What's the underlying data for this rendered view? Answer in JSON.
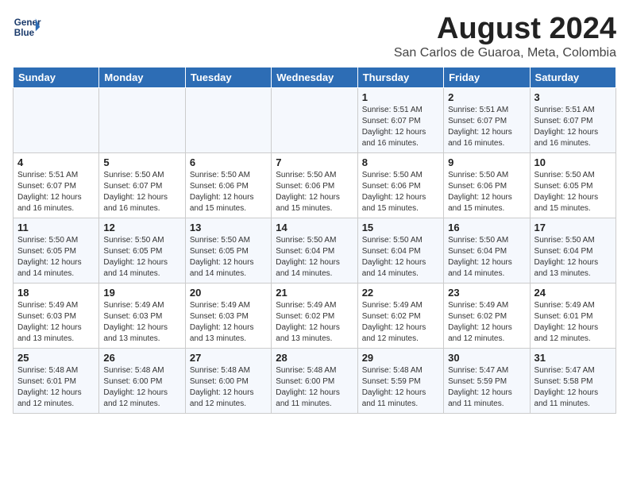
{
  "header": {
    "logo_line1": "General",
    "logo_line2": "Blue",
    "title": "August 2024",
    "subtitle": "San Carlos de Guaroa, Meta, Colombia"
  },
  "weekdays": [
    "Sunday",
    "Monday",
    "Tuesday",
    "Wednesday",
    "Thursday",
    "Friday",
    "Saturday"
  ],
  "weeks": [
    [
      {
        "day": "",
        "info": ""
      },
      {
        "day": "",
        "info": ""
      },
      {
        "day": "",
        "info": ""
      },
      {
        "day": "",
        "info": ""
      },
      {
        "day": "1",
        "info": "Sunrise: 5:51 AM\nSunset: 6:07 PM\nDaylight: 12 hours\nand 16 minutes."
      },
      {
        "day": "2",
        "info": "Sunrise: 5:51 AM\nSunset: 6:07 PM\nDaylight: 12 hours\nand 16 minutes."
      },
      {
        "day": "3",
        "info": "Sunrise: 5:51 AM\nSunset: 6:07 PM\nDaylight: 12 hours\nand 16 minutes."
      }
    ],
    [
      {
        "day": "4",
        "info": "Sunrise: 5:51 AM\nSunset: 6:07 PM\nDaylight: 12 hours\nand 16 minutes."
      },
      {
        "day": "5",
        "info": "Sunrise: 5:50 AM\nSunset: 6:07 PM\nDaylight: 12 hours\nand 16 minutes."
      },
      {
        "day": "6",
        "info": "Sunrise: 5:50 AM\nSunset: 6:06 PM\nDaylight: 12 hours\nand 15 minutes."
      },
      {
        "day": "7",
        "info": "Sunrise: 5:50 AM\nSunset: 6:06 PM\nDaylight: 12 hours\nand 15 minutes."
      },
      {
        "day": "8",
        "info": "Sunrise: 5:50 AM\nSunset: 6:06 PM\nDaylight: 12 hours\nand 15 minutes."
      },
      {
        "day": "9",
        "info": "Sunrise: 5:50 AM\nSunset: 6:06 PM\nDaylight: 12 hours\nand 15 minutes."
      },
      {
        "day": "10",
        "info": "Sunrise: 5:50 AM\nSunset: 6:05 PM\nDaylight: 12 hours\nand 15 minutes."
      }
    ],
    [
      {
        "day": "11",
        "info": "Sunrise: 5:50 AM\nSunset: 6:05 PM\nDaylight: 12 hours\nand 14 minutes."
      },
      {
        "day": "12",
        "info": "Sunrise: 5:50 AM\nSunset: 6:05 PM\nDaylight: 12 hours\nand 14 minutes."
      },
      {
        "day": "13",
        "info": "Sunrise: 5:50 AM\nSunset: 6:05 PM\nDaylight: 12 hours\nand 14 minutes."
      },
      {
        "day": "14",
        "info": "Sunrise: 5:50 AM\nSunset: 6:04 PM\nDaylight: 12 hours\nand 14 minutes."
      },
      {
        "day": "15",
        "info": "Sunrise: 5:50 AM\nSunset: 6:04 PM\nDaylight: 12 hours\nand 14 minutes."
      },
      {
        "day": "16",
        "info": "Sunrise: 5:50 AM\nSunset: 6:04 PM\nDaylight: 12 hours\nand 14 minutes."
      },
      {
        "day": "17",
        "info": "Sunrise: 5:50 AM\nSunset: 6:04 PM\nDaylight: 12 hours\nand 13 minutes."
      }
    ],
    [
      {
        "day": "18",
        "info": "Sunrise: 5:49 AM\nSunset: 6:03 PM\nDaylight: 12 hours\nand 13 minutes."
      },
      {
        "day": "19",
        "info": "Sunrise: 5:49 AM\nSunset: 6:03 PM\nDaylight: 12 hours\nand 13 minutes."
      },
      {
        "day": "20",
        "info": "Sunrise: 5:49 AM\nSunset: 6:03 PM\nDaylight: 12 hours\nand 13 minutes."
      },
      {
        "day": "21",
        "info": "Sunrise: 5:49 AM\nSunset: 6:02 PM\nDaylight: 12 hours\nand 13 minutes."
      },
      {
        "day": "22",
        "info": "Sunrise: 5:49 AM\nSunset: 6:02 PM\nDaylight: 12 hours\nand 12 minutes."
      },
      {
        "day": "23",
        "info": "Sunrise: 5:49 AM\nSunset: 6:02 PM\nDaylight: 12 hours\nand 12 minutes."
      },
      {
        "day": "24",
        "info": "Sunrise: 5:49 AM\nSunset: 6:01 PM\nDaylight: 12 hours\nand 12 minutes."
      }
    ],
    [
      {
        "day": "25",
        "info": "Sunrise: 5:48 AM\nSunset: 6:01 PM\nDaylight: 12 hours\nand 12 minutes."
      },
      {
        "day": "26",
        "info": "Sunrise: 5:48 AM\nSunset: 6:00 PM\nDaylight: 12 hours\nand 12 minutes."
      },
      {
        "day": "27",
        "info": "Sunrise: 5:48 AM\nSunset: 6:00 PM\nDaylight: 12 hours\nand 12 minutes."
      },
      {
        "day": "28",
        "info": "Sunrise: 5:48 AM\nSunset: 6:00 PM\nDaylight: 12 hours\nand 11 minutes."
      },
      {
        "day": "29",
        "info": "Sunrise: 5:48 AM\nSunset: 5:59 PM\nDaylight: 12 hours\nand 11 minutes."
      },
      {
        "day": "30",
        "info": "Sunrise: 5:47 AM\nSunset: 5:59 PM\nDaylight: 12 hours\nand 11 minutes."
      },
      {
        "day": "31",
        "info": "Sunrise: 5:47 AM\nSunset: 5:58 PM\nDaylight: 12 hours\nand 11 minutes."
      }
    ]
  ]
}
